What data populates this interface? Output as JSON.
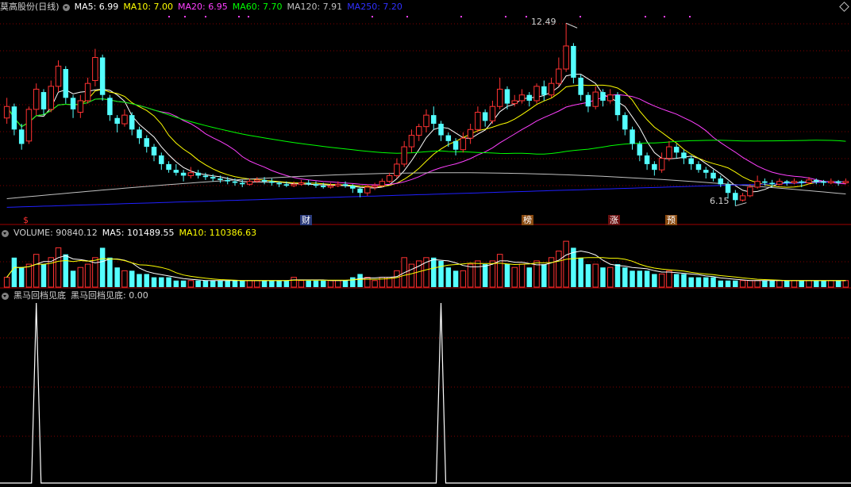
{
  "main_header": {
    "stock_name": "莫高股份(日线)",
    "ma5": "MA5: 6.99",
    "ma10": "MA10: 7.00",
    "ma20": "MA20: 6.95",
    "ma60": "MA60: 7.70",
    "ma120": "MA120: 7.91",
    "ma250": "MA250: 7.20"
  },
  "volume_header": {
    "label": "VOLUME: 90840.12",
    "ma5": "MA5: 101489.55",
    "ma10": "MA10: 110386.63"
  },
  "indicator_header": {
    "name": "黑马回档见底",
    "value": "黑马回档见底: 0.00"
  },
  "price_annotations": {
    "high": "12.49",
    "low": "6.15"
  },
  "event_markers": [
    "$",
    "财",
    "榜",
    "涨",
    "预"
  ],
  "colors": {
    "up": "#ff3232",
    "down": "#54ffff",
    "ma5": "#ffffff",
    "ma10": "#ffff00",
    "ma20": "#ff40ff",
    "ma60": "#00ff00",
    "ma120": "#c0c0c0",
    "ma250": "#2020ff",
    "grid": "#800000"
  },
  "chart_data": {
    "type": "candlestick",
    "y_range": [
      6.0,
      12.8
    ],
    "candles": [
      [
        9.2,
        9.6,
        9.9,
        9.0
      ],
      [
        9.6,
        8.8,
        9.7,
        8.6
      ],
      [
        8.8,
        8.3,
        9.0,
        8.1
      ],
      [
        8.4,
        9.5,
        9.6,
        8.3
      ],
      [
        9.5,
        10.2,
        10.4,
        9.3
      ],
      [
        10.1,
        9.5,
        10.2,
        9.3
      ],
      [
        9.5,
        10.3,
        10.5,
        9.4
      ],
      [
        10.3,
        11.0,
        11.2,
        10.1
      ],
      [
        10.9,
        9.9,
        11.0,
        9.7
      ],
      [
        9.9,
        9.5,
        10.0,
        9.2
      ],
      [
        9.4,
        9.8,
        10.0,
        9.2
      ],
      [
        9.8,
        10.4,
        10.6,
        9.7
      ],
      [
        10.5,
        11.3,
        11.6,
        10.3
      ],
      [
        11.3,
        10.0,
        11.4,
        9.8
      ],
      [
        9.9,
        9.3,
        10.0,
        9.1
      ],
      [
        9.2,
        9.0,
        9.3,
        8.7
      ],
      [
        9.0,
        9.3,
        9.5,
        8.9
      ],
      [
        9.3,
        8.8,
        9.4,
        8.6
      ],
      [
        8.8,
        8.5,
        8.9,
        8.3
      ],
      [
        8.5,
        8.2,
        8.6,
        8.0
      ],
      [
        8.2,
        7.9,
        8.3,
        7.7
      ],
      [
        7.9,
        7.6,
        8.0,
        7.4
      ],
      [
        7.6,
        7.4,
        7.7,
        7.3
      ],
      [
        7.4,
        7.3,
        7.6,
        7.2
      ],
      [
        7.3,
        7.2,
        7.4,
        7.0
      ],
      [
        7.2,
        7.3,
        7.5,
        7.1
      ],
      [
        7.3,
        7.2,
        7.4,
        7.1
      ],
      [
        7.2,
        7.15,
        7.3,
        7.05
      ],
      [
        7.15,
        7.1,
        7.25,
        7.0
      ],
      [
        7.1,
        7.05,
        7.2,
        6.95
      ],
      [
        7.05,
        7.0,
        7.15,
        6.9
      ],
      [
        7.0,
        6.95,
        7.1,
        6.85
      ],
      [
        6.95,
        6.9,
        7.05,
        6.8
      ],
      [
        6.9,
        7.0,
        7.1,
        6.85
      ],
      [
        7.0,
        7.05,
        7.15,
        6.95
      ],
      [
        7.05,
        7.0,
        7.15,
        6.9
      ],
      [
        7.0,
        6.95,
        7.1,
        6.85
      ],
      [
        6.95,
        6.9,
        7.0,
        6.8
      ],
      [
        6.9,
        6.85,
        7.0,
        6.8
      ],
      [
        6.85,
        6.9,
        7.0,
        6.8
      ],
      [
        6.9,
        6.95,
        7.05,
        6.85
      ],
      [
        6.95,
        6.9,
        7.05,
        6.85
      ],
      [
        6.9,
        6.85,
        7.0,
        6.78
      ],
      [
        6.85,
        6.8,
        6.95,
        6.75
      ],
      [
        6.8,
        6.85,
        6.95,
        6.75
      ],
      [
        6.85,
        6.9,
        7.0,
        6.8
      ],
      [
        6.9,
        6.85,
        7.0,
        6.78
      ],
      [
        6.85,
        6.75,
        6.9,
        6.6
      ],
      [
        6.75,
        6.6,
        6.8,
        6.45
      ],
      [
        6.6,
        6.8,
        6.9,
        6.5
      ],
      [
        6.8,
        6.85,
        6.95,
        6.7
      ],
      [
        6.85,
        7.0,
        7.1,
        6.8
      ],
      [
        7.0,
        7.2,
        7.3,
        6.95
      ],
      [
        7.2,
        7.6,
        7.8,
        7.1
      ],
      [
        7.6,
        8.2,
        8.4,
        7.5
      ],
      [
        8.2,
        8.6,
        8.8,
        8.0
      ],
      [
        8.6,
        8.9,
        9.0,
        8.4
      ],
      [
        8.9,
        9.3,
        9.5,
        8.7
      ],
      [
        9.3,
        9.0,
        9.6,
        8.8
      ],
      [
        9.0,
        8.6,
        9.1,
        8.4
      ],
      [
        8.6,
        8.4,
        8.7,
        8.2
      ],
      [
        8.4,
        8.1,
        8.5,
        7.9
      ],
      [
        8.1,
        8.5,
        8.7,
        8.0
      ],
      [
        8.5,
        8.8,
        9.0,
        8.3
      ],
      [
        8.8,
        9.4,
        9.6,
        8.7
      ],
      [
        9.4,
        9.1,
        9.5,
        8.9
      ],
      [
        9.1,
        9.6,
        9.8,
        9.0
      ],
      [
        9.6,
        10.2,
        10.6,
        9.5
      ],
      [
        10.2,
        9.7,
        10.3,
        9.5
      ],
      [
        9.7,
        9.8,
        10.0,
        9.6
      ],
      [
        9.8,
        10.0,
        10.2,
        9.7
      ],
      [
        10.0,
        9.8,
        10.1,
        9.6
      ],
      [
        9.8,
        10.3,
        10.4,
        9.7
      ],
      [
        10.3,
        10.0,
        10.5,
        9.8
      ],
      [
        10.0,
        10.4,
        10.6,
        9.9
      ],
      [
        10.4,
        10.9,
        11.3,
        10.3
      ],
      [
        10.9,
        11.7,
        12.49,
        10.8
      ],
      [
        11.7,
        10.6,
        11.8,
        10.4
      ],
      [
        10.6,
        10.0,
        10.7,
        9.8
      ],
      [
        10.0,
        9.6,
        10.1,
        9.4
      ],
      [
        9.6,
        10.1,
        10.3,
        9.5
      ],
      [
        10.1,
        9.8,
        10.2,
        9.6
      ],
      [
        9.8,
        10.0,
        10.2,
        9.7
      ],
      [
        10.0,
        9.3,
        10.1,
        9.1
      ],
      [
        9.3,
        8.8,
        9.4,
        8.6
      ],
      [
        8.8,
        8.3,
        8.9,
        8.1
      ],
      [
        8.3,
        7.9,
        8.4,
        7.7
      ],
      [
        7.9,
        7.6,
        8.0,
        7.4
      ],
      [
        7.6,
        7.4,
        7.7,
        7.2
      ],
      [
        7.4,
        7.8,
        8.0,
        7.3
      ],
      [
        7.8,
        8.2,
        8.4,
        7.7
      ],
      [
        8.2,
        8.0,
        8.3,
        7.8
      ],
      [
        8.0,
        7.8,
        8.1,
        7.6
      ],
      [
        7.8,
        7.6,
        7.9,
        7.4
      ],
      [
        7.6,
        7.4,
        7.7,
        7.3
      ],
      [
        7.4,
        7.3,
        7.5,
        7.1
      ],
      [
        7.3,
        7.1,
        7.4,
        7.0
      ],
      [
        7.1,
        6.9,
        7.2,
        6.8
      ],
      [
        6.9,
        6.6,
        7.0,
        6.4
      ],
      [
        6.6,
        6.35,
        6.7,
        6.15
      ],
      [
        6.35,
        6.5,
        6.6,
        6.3
      ],
      [
        6.5,
        6.8,
        6.9,
        6.45
      ],
      [
        6.8,
        7.0,
        7.2,
        6.75
      ],
      [
        7.0,
        6.95,
        7.1,
        6.85
      ],
      [
        6.95,
        6.9,
        7.05,
        6.8
      ],
      [
        6.9,
        7.0,
        7.1,
        6.85
      ],
      [
        7.0,
        6.95,
        7.05,
        6.85
      ],
      [
        6.95,
        7.0,
        7.1,
        6.9
      ],
      [
        7.0,
        6.95,
        7.05,
        6.8
      ],
      [
        6.95,
        7.05,
        7.15,
        6.9
      ],
      [
        7.05,
        7.0,
        7.1,
        6.9
      ],
      [
        7.0,
        6.95,
        7.05,
        6.85
      ],
      [
        6.95,
        7.0,
        7.1,
        6.9
      ],
      [
        7.0,
        6.95,
        7.05,
        6.85
      ],
      [
        6.95,
        7.0,
        7.1,
        6.9
      ]
    ],
    "volume": [
      3,
      9,
      6,
      7,
      10,
      7,
      9,
      12,
      10,
      5,
      6,
      7,
      9,
      12,
      9,
      6,
      5,
      5,
      4,
      4,
      3,
      3,
      3,
      2,
      2,
      2,
      2,
      2,
      2,
      2,
      2,
      2,
      2,
      2,
      2,
      2,
      2,
      2,
      2,
      3,
      2,
      2,
      2,
      2,
      2,
      2,
      2,
      3,
      4,
      3,
      2,
      3,
      3,
      5,
      9,
      7,
      8,
      9,
      9,
      8,
      6,
      5,
      5,
      7,
      8,
      7,
      8,
      10,
      7,
      6,
      7,
      6,
      8,
      7,
      9,
      11,
      14,
      12,
      9,
      7,
      7,
      6,
      6,
      7,
      6,
      5,
      5,
      5,
      4,
      4,
      5,
      4,
      4,
      3,
      3,
      3,
      3,
      2,
      2,
      2,
      2,
      2,
      2,
      2,
      2,
      2,
      2,
      2,
      2,
      2,
      2,
      2,
      2,
      2,
      2
    ],
    "indicator_spikes": [
      4,
      59
    ]
  }
}
